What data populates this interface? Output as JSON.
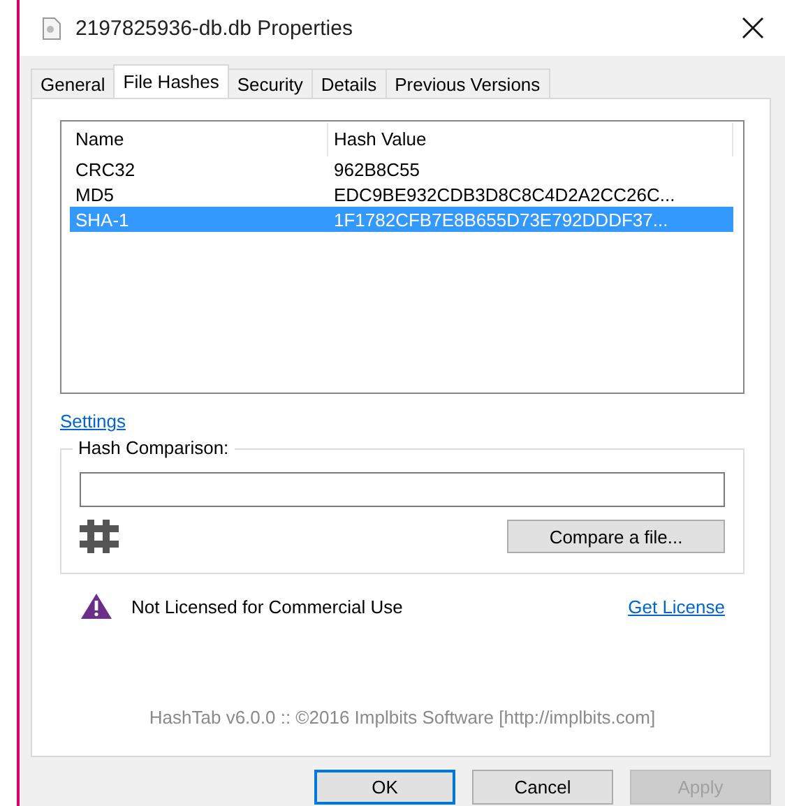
{
  "window": {
    "title": "2197825936-db.db Properties"
  },
  "tabs": [
    {
      "label": "General",
      "selected": false
    },
    {
      "label": "File Hashes",
      "selected": true
    },
    {
      "label": "Security",
      "selected": false
    },
    {
      "label": "Details",
      "selected": false
    },
    {
      "label": "Previous Versions",
      "selected": false
    }
  ],
  "table": {
    "columns": [
      "Name",
      "Hash Value"
    ],
    "rows": [
      {
        "cells": [
          "CRC32",
          "962B8C55"
        ],
        "selected": false
      },
      {
        "cells": [
          "MD5",
          "EDC9BE932CDB3D8C8C4D2A2CC26C..."
        ],
        "selected": false
      },
      {
        "cells": [
          "SHA-1",
          "1F1782CFB7E8B655D73E792DDDF37..."
        ],
        "selected": true
      }
    ]
  },
  "settings_link": "Settings",
  "hash_comparison": {
    "title": "Hash Comparison:",
    "compare_button": "Compare a file..."
  },
  "license": {
    "message": "Not Licensed for Commercial Use",
    "link": "Get License"
  },
  "footer": "HashTab v6.0.0 :: ©2016 Implbits Software [http://implbits.com]",
  "buttons": [
    {
      "label": "OK",
      "default": true,
      "disabled": false
    },
    {
      "label": "Cancel",
      "default": false,
      "disabled": false
    },
    {
      "label": "Apply",
      "default": false,
      "disabled": true
    }
  ]
}
